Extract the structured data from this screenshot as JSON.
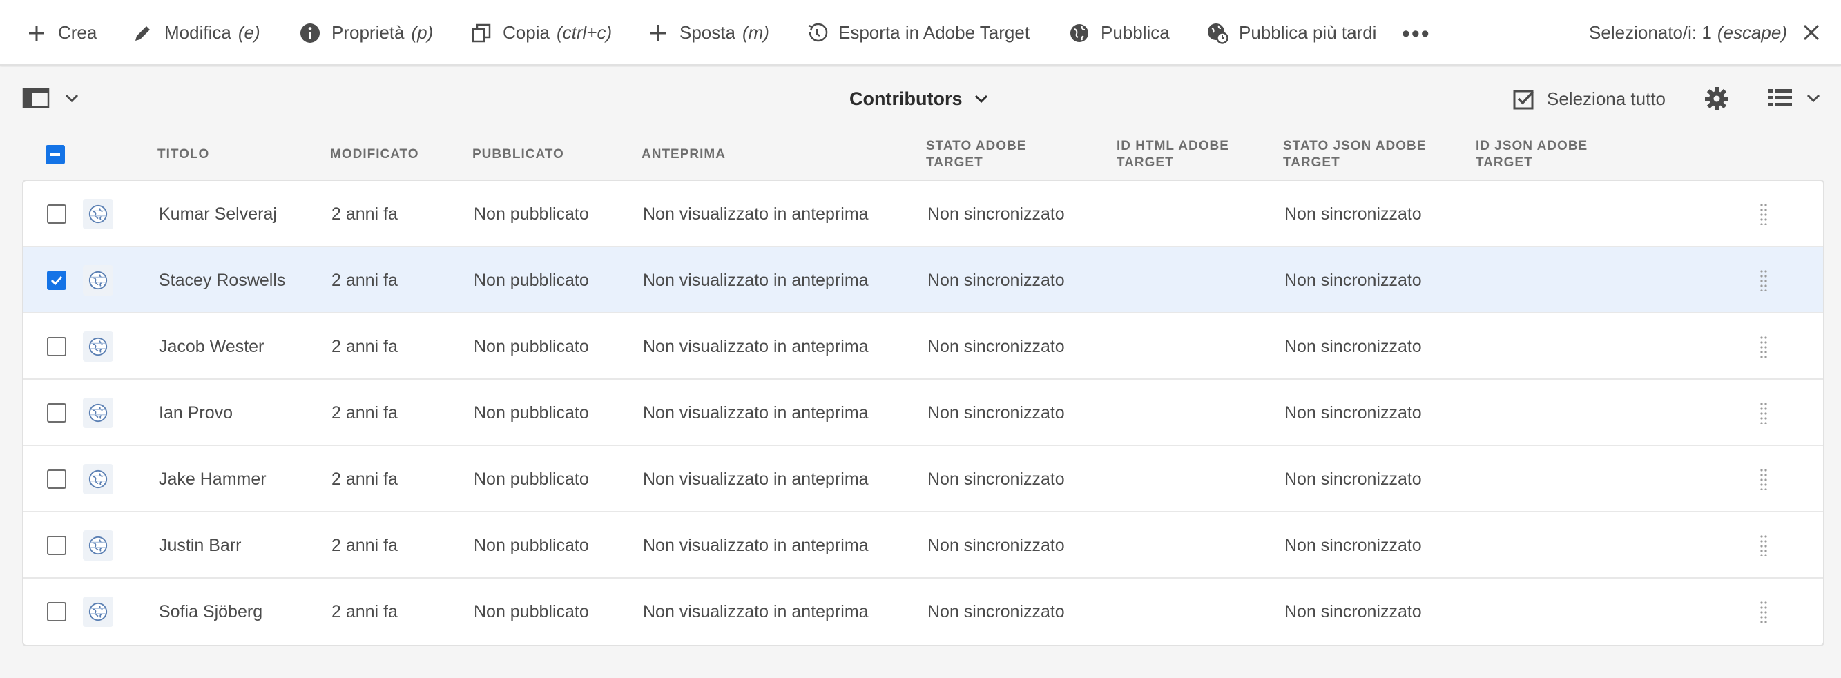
{
  "actionbar": {
    "actions": [
      {
        "label": "Crea",
        "shortcut": "",
        "icon": "plus-icon"
      },
      {
        "label": "Modifica",
        "shortcut": "(e)",
        "icon": "pencil-icon"
      },
      {
        "label": "Proprietà",
        "shortcut": "(p)",
        "icon": "info-icon"
      },
      {
        "label": "Copia",
        "shortcut": "(ctrl+c)",
        "icon": "copy-icon"
      },
      {
        "label": "Sposta",
        "shortcut": "(m)",
        "icon": "move-icon"
      },
      {
        "label": "Esporta in Adobe Target",
        "shortcut": "",
        "icon": "export-target-icon"
      },
      {
        "label": "Pubblica",
        "shortcut": "",
        "icon": "globe-icon"
      },
      {
        "label": "Pubblica più tardi",
        "shortcut": "",
        "icon": "globe-clock-icon"
      }
    ],
    "more_label": "•••",
    "selected_label": "Selezionato/i: 1",
    "selected_shortcut": "(escape)"
  },
  "subbar": {
    "title": "Contributors",
    "select_all_label": "Seleziona tutto"
  },
  "table": {
    "headers": [
      "TITOLO",
      "MODIFICATO",
      "PUBBLICATO",
      "ANTEPRIMA",
      "STATO ADOBE TARGET",
      "ID HTML ADOBE TARGET",
      "STATO JSON ADOBE TARGET",
      "ID JSON ADOBE TARGET"
    ],
    "rows": [
      {
        "title": "Kumar Selveraj",
        "modified": "2 anni fa",
        "published": "Non pubblicato",
        "preview": "Non visualizzato in anteprima",
        "target_status": "Non sincronizzato",
        "target_html_id": "",
        "target_json_status": "Non sincronizzato",
        "target_json_id": "",
        "selected": false
      },
      {
        "title": "Stacey Roswells",
        "modified": "2 anni fa",
        "published": "Non pubblicato",
        "preview": "Non visualizzato in anteprima",
        "target_status": "Non sincronizzato",
        "target_html_id": "",
        "target_json_status": "Non sincronizzato",
        "target_json_id": "",
        "selected": true
      },
      {
        "title": "Jacob Wester",
        "modified": "2 anni fa",
        "published": "Non pubblicato",
        "preview": "Non visualizzato in anteprima",
        "target_status": "Non sincronizzato",
        "target_html_id": "",
        "target_json_status": "Non sincronizzato",
        "target_json_id": "",
        "selected": false
      },
      {
        "title": "Ian Provo",
        "modified": "2 anni fa",
        "published": "Non pubblicato",
        "preview": "Non visualizzato in anteprima",
        "target_status": "Non sincronizzato",
        "target_html_id": "",
        "target_json_status": "Non sincronizzato",
        "target_json_id": "",
        "selected": false
      },
      {
        "title": "Jake Hammer",
        "modified": "2 anni fa",
        "published": "Non pubblicato",
        "preview": "Non visualizzato in anteprima",
        "target_status": "Non sincronizzato",
        "target_html_id": "",
        "target_json_status": "Non sincronizzato",
        "target_json_id": "",
        "selected": false
      },
      {
        "title": "Justin Barr",
        "modified": "2 anni fa",
        "published": "Non pubblicato",
        "preview": "Non visualizzato in anteprima",
        "target_status": "Non sincronizzato",
        "target_html_id": "",
        "target_json_status": "Non sincronizzato",
        "target_json_id": "",
        "selected": false
      },
      {
        "title": "Sofia Sjöberg",
        "modified": "2 anni fa",
        "published": "Non pubblicato",
        "preview": "Non visualizzato in anteprima",
        "target_status": "Non sincronizzato",
        "target_html_id": "",
        "target_json_status": "Non sincronizzato",
        "target_json_id": "",
        "selected": false
      }
    ]
  },
  "colors": {
    "accent": "#1473e6",
    "selected_row": "#e9f1fc",
    "text": "#4b4b4b"
  }
}
